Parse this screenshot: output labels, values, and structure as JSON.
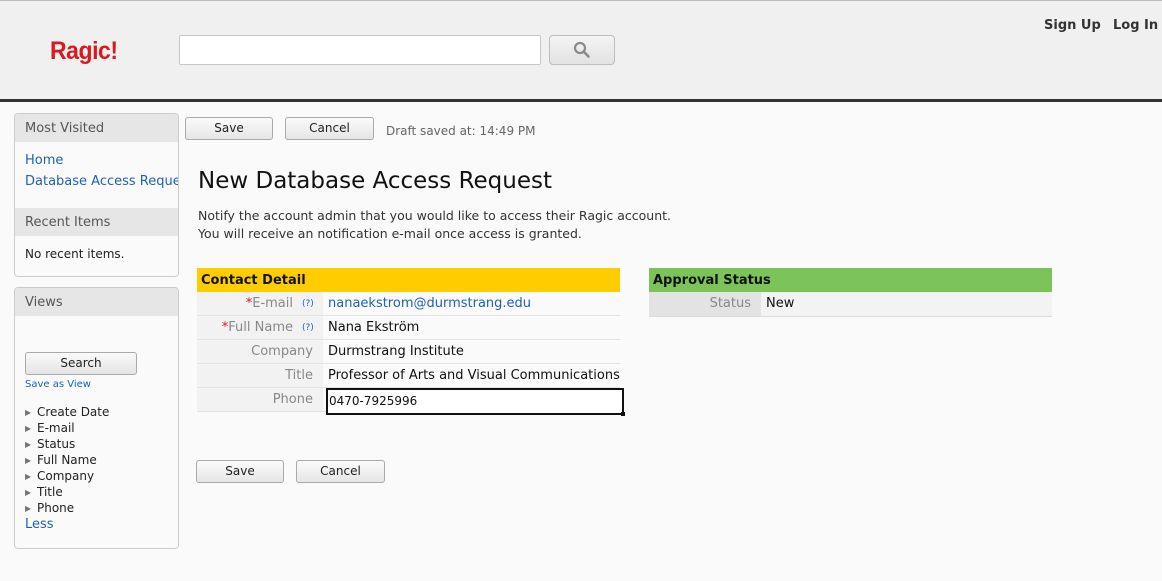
{
  "header": {
    "logo": "Ragic!",
    "search": {
      "value": "",
      "placeholder": ""
    },
    "links": {
      "sign_up": "Sign Up",
      "log_in": "Log In"
    }
  },
  "sidebar": {
    "most_visited": {
      "title": "Most Visited",
      "items": [
        "Home",
        "Database Access Reque"
      ]
    },
    "recent_items": {
      "title": "Recent Items",
      "empty_text": "No recent items."
    },
    "views": {
      "title": "Views",
      "search_label": "Search",
      "save_as_view": "Save as View",
      "fields": [
        "Create Date",
        "E-mail",
        "Status",
        "Full Name",
        "Company",
        "Title",
        "Phone"
      ],
      "less_label": "Less"
    }
  },
  "toolbar": {
    "save_label": "Save",
    "cancel_label": "Cancel",
    "draft_status": "Draft saved at: 14:49 PM"
  },
  "form": {
    "title": "New Database Access Request",
    "description": [
      "Notify the account admin that you would like to access their Ragic account.",
      "You will receive an notification e-mail once access is granted."
    ],
    "contact_detail": {
      "title": "Contact Detail",
      "fields": [
        {
          "label": "E-mail",
          "required": "*",
          "help": "(?)",
          "value": "nanaekstrom@durmstrang.edu"
        },
        {
          "label": "Full Name",
          "required": "*",
          "help": "(?)",
          "value": "Nana Ekström"
        },
        {
          "label": "Company",
          "value": "Durmstrang Institute"
        },
        {
          "label": "Title",
          "value": "Professor of Arts and Visual Communications"
        },
        {
          "label": "Phone",
          "value": "0470-7925996"
        }
      ]
    },
    "approval_status": {
      "title": "Approval Status",
      "fields": [
        {
          "label": "Status",
          "value": "New"
        }
      ]
    }
  },
  "colors": {
    "logo": "#d8191e",
    "link": "#1f61b5",
    "contact_header": "#ffcc00",
    "approval_header": "#7cc35a"
  }
}
